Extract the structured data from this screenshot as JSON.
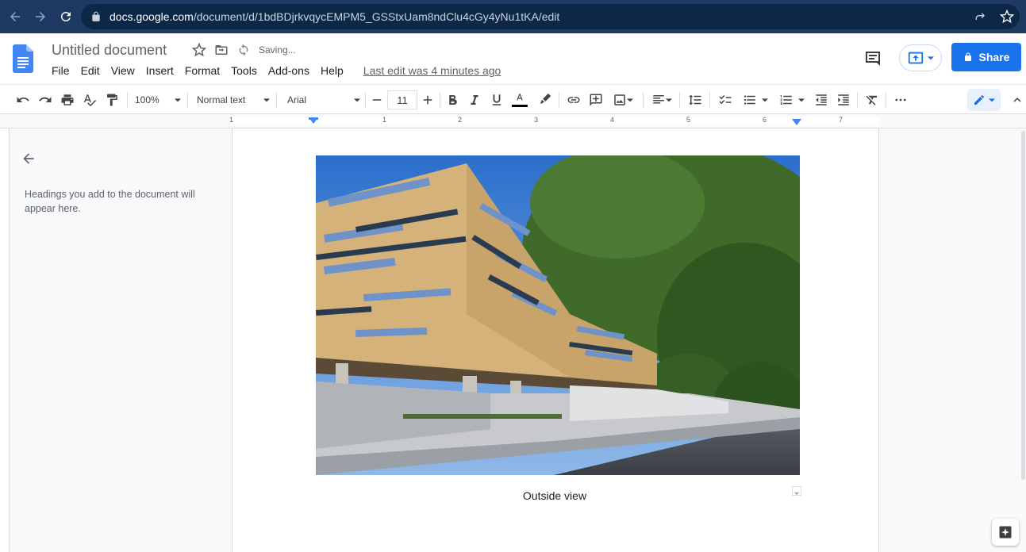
{
  "browser": {
    "url_host": "docs.google.com",
    "url_path": "/document/d/1bdBDjrkvqycEMPM5_GSStxUam8ndClu4cGy4yNu1tKA/edit"
  },
  "doc": {
    "title": "Untitled document",
    "saving_status": "Saving...",
    "last_edit": "Last edit was 4 minutes ago",
    "share_label": "Share"
  },
  "menu": [
    "File",
    "Edit",
    "View",
    "Insert",
    "Format",
    "Tools",
    "Add-ons",
    "Help"
  ],
  "toolbar": {
    "zoom": "100%",
    "style": "Normal text",
    "font": "Arial",
    "font_size": "11"
  },
  "ruler": {
    "numbers": [
      "1",
      "1",
      "2",
      "3",
      "4",
      "5",
      "6",
      "7"
    ]
  },
  "outline": {
    "placeholder": "Headings you add to the document will appear here."
  },
  "content": {
    "caption": "Outside view"
  },
  "colors": {
    "browser_bar": "#1e3a63",
    "share_blue": "#1a73e8",
    "docs_blue": "#4285f4"
  }
}
